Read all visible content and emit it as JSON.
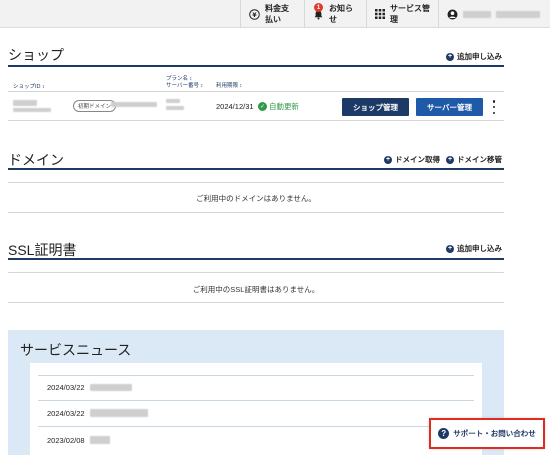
{
  "topbar": {
    "billing_label": "料金支払い",
    "billing_icon": "yen-icon",
    "notice_label": "お知らせ",
    "notice_badge": "1",
    "services_label": "サービス管理"
  },
  "shop": {
    "title": "ショップ",
    "add_label": "追加申し込み",
    "col_shop_id": "ショップID ↕",
    "col_plan": "プラン名 ↕",
    "col_server": "サーバー番号 ↕",
    "col_expiry": "利用期限 ↕",
    "row": {
      "domain_badge": "初期ドメイン",
      "expiry": "2024/12/31",
      "auto_renew": "自動更新",
      "shop_manage_label": "ショップ管理",
      "server_manage_label": "サーバー管理"
    }
  },
  "domain": {
    "title": "ドメイン",
    "acquire_label": "ドメイン取得",
    "transfer_label": "ドメイン移管",
    "empty": "ご利用中のドメインはありません。"
  },
  "ssl": {
    "title": "SSL証明書",
    "add_label": "追加申し込み",
    "empty": "ご利用中のSSL証明書はありません。"
  },
  "news": {
    "title": "サービスニュース",
    "items": [
      {
        "date": "2024/03/22"
      },
      {
        "date": "2024/03/22"
      },
      {
        "date": "2023/02/08"
      }
    ]
  },
  "support": {
    "label": "サポート・お問い合わせ"
  }
}
